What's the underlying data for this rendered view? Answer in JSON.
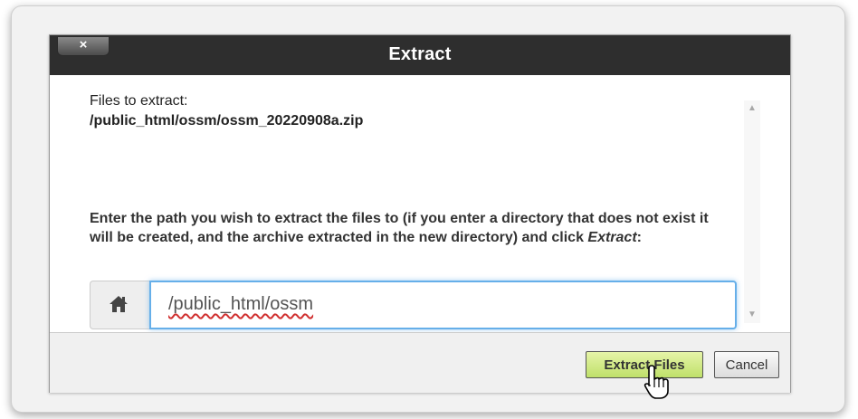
{
  "dialog": {
    "title": "Extract",
    "close_label": "×"
  },
  "content": {
    "files_label": "Files to extract:",
    "file_path": "/public_html/ossm/ossm_20220908a.zip",
    "instruction_prefix": "Enter the path you wish to extract the files to (if you enter a directory that does not exist it will be created, and the archive extracted in the new directory) and click ",
    "instruction_action": "Extract",
    "instruction_suffix": ":",
    "path_value": "/public_html/ossm"
  },
  "footer": {
    "extract_label": "Extract Files",
    "cancel_label": "Cancel"
  },
  "icons": {
    "home": "home-icon",
    "close": "close-icon",
    "cursor": "hand-pointer-icon"
  },
  "colors": {
    "titlebar": "#2e2e2e",
    "extract_button": "#bfe06a",
    "input_focus": "#66afe9"
  }
}
